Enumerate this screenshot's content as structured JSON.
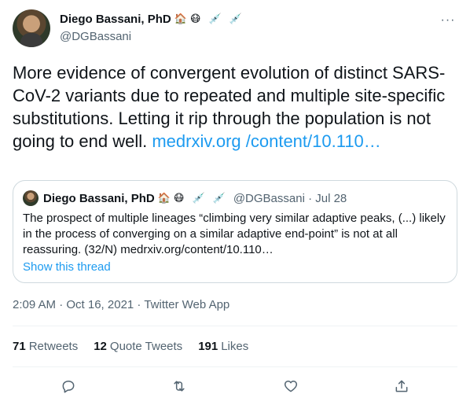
{
  "tweet": {
    "author": {
      "name": "Diego Bassani, PhD",
      "handle": "@DGBassani",
      "badges": [
        "🏠",
        "😷",
        "💉",
        "💉"
      ]
    },
    "text_main": "More evidence of convergent evolution of distinct SARS- CoV-2 variants due to repeated and multiple site-specific substitutions. Letting it rip through the population is not going to end well. ",
    "link_text": "medrxiv.org /content/10.110…",
    "timestamp": "2:09 AM · Oct 16, 2021 · Twitter Web App",
    "stats": [
      {
        "count": "71",
        "label": "Retweets"
      },
      {
        "count": "12",
        "label": "Quote Tweets"
      },
      {
        "count": "191",
        "label": "Likes"
      }
    ]
  },
  "quote": {
    "name": "Diego Bassani, PhD",
    "badges": [
      "🏠",
      "😷",
      "💉",
      "💉"
    ],
    "meta": "@DGBassani · Jul 28",
    "text": "The prospect of multiple lineages “climbing very similar adaptive peaks, (...) likely in the process of converging on a similar adaptive end-point” is not at all reassuring.  (32/N) medrxiv.org/content/10.110…",
    "show_thread": "Show this thread"
  },
  "icons": {
    "more": "more-icon",
    "reply": "reply-icon",
    "retweet": "retweet-icon",
    "like": "heart-icon",
    "share": "share-icon"
  },
  "colors": {
    "accent": "#1d9bf0",
    "secondary_text": "#536471",
    "border": "#cfd9de"
  }
}
